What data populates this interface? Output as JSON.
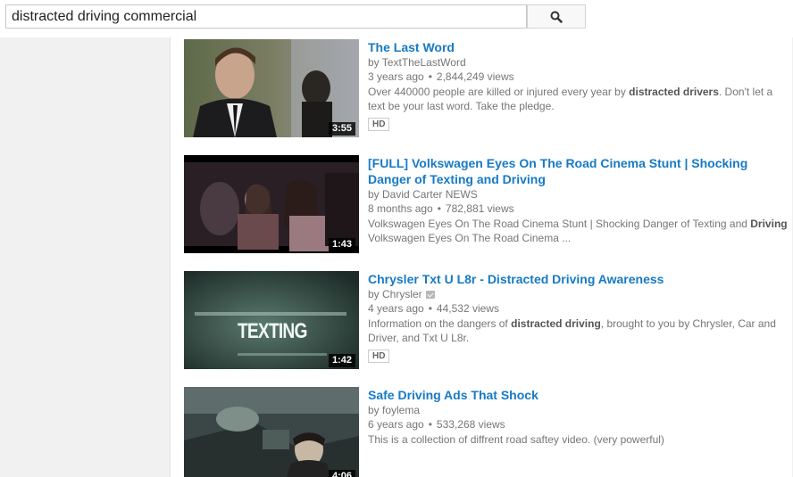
{
  "search": {
    "value": "distracted driving commercial",
    "button_icon": "search-icon"
  },
  "results": [
    {
      "title": "The Last Word",
      "channel": "by TextTheLastWord",
      "age": "3 years ago",
      "views": "2,844,249 views",
      "desc_parts": [
        "Over 440000 people are killed or injured every year by ",
        "distracted drivers",
        ". Don't let a text be your last word. Take the pledge."
      ],
      "duration": "3:55",
      "badge": "HD"
    },
    {
      "title": "[FULL] Volkswagen Eyes On The Road Cinema Stunt | Shocking Danger of Texting and Driving",
      "channel": "by David Carter NEWS",
      "age": "8 months ago",
      "views": "782,881 views",
      "desc_parts": [
        "Volkswagen Eyes On The Road Cinema Stunt | Shocking Danger of Texting and ",
        "Driving",
        " Volkswagen Eyes On The Road Cinema ..."
      ],
      "duration": "1:43",
      "badge": ""
    },
    {
      "title": "Chrysler Txt U L8r - Distracted Driving Awareness",
      "channel": "by Chrysler",
      "age": "4 years ago",
      "views": "44,532 views",
      "desc_parts": [
        "Information on the dangers of ",
        "distracted driving",
        ", brought to you by Chrysler, Car and Driver, and Txt U L8r."
      ],
      "duration": "1:42",
      "badge": "HD",
      "thumb_text": "TEXTING"
    },
    {
      "title": "Safe Driving Ads That Shock",
      "channel": "by foylema",
      "age": "6 years ago",
      "views": "533,268 views",
      "desc_parts": [
        "This is a collection of diffrent road saftey video. (very powerful)",
        "",
        ""
      ],
      "duration": "4:06",
      "badge": ""
    }
  ]
}
